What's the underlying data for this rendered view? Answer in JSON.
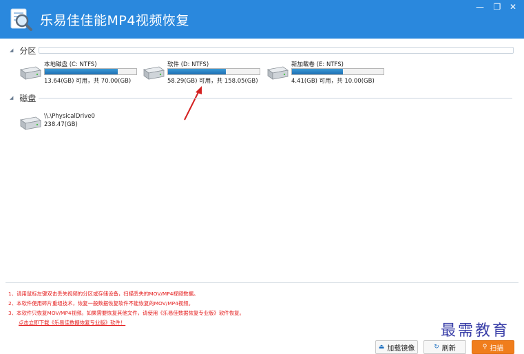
{
  "app": {
    "title": "乐易佳佳能MP4视频恢复",
    "window_controls": {
      "minimize": "—",
      "maximize": "❐",
      "close": "✕"
    }
  },
  "partitions": {
    "label": "分区",
    "drives": [
      {
        "name": "本地磁盘 (C: NTFS)",
        "size": "13.64(GB) 可用，共 70.00(GB)",
        "used_fraction": 0.8
      },
      {
        "name": "软件 (D: NTFS)",
        "size": "58.29(GB) 可用，共 158.05(GB)",
        "used_fraction": 0.63
      },
      {
        "name": "新加载卷 (E: NTFS)",
        "size": "4.41(GB) 可用，共 10.00(GB)",
        "used_fraction": 0.56
      }
    ]
  },
  "disks": {
    "label": "磁盘",
    "items": [
      {
        "name": "\\\\.\\PhysicalDrive0",
        "size": "238.47(GB)"
      }
    ]
  },
  "notes": {
    "lines": [
      "1、请用鼠标左键双击丢失视频的分区或存储设备，扫描丢失的MOV/MP4视频数据。",
      "2、本软件使用碎片重组技术，恢复一般数据恢复软件不能恢复的MOV/MP4视频。",
      "3、本软件只恢复MOV/MP4视频。如果需要恢复其他文件，请使用《乐易佳数据恢复专业版》软件恢复。"
    ],
    "link": "点击立即下载《乐易佳数据恢复专业版》软件！"
  },
  "watermark": "最需教育",
  "buttons": {
    "load_image": "加载镜像",
    "refresh": "刷新",
    "scan": "扫描"
  },
  "colors": {
    "titlebar": "#2a88dd",
    "accent_orange": "#f07d1c",
    "note_red": "#e41b1b",
    "progress_blue": "#1e6fb3"
  }
}
